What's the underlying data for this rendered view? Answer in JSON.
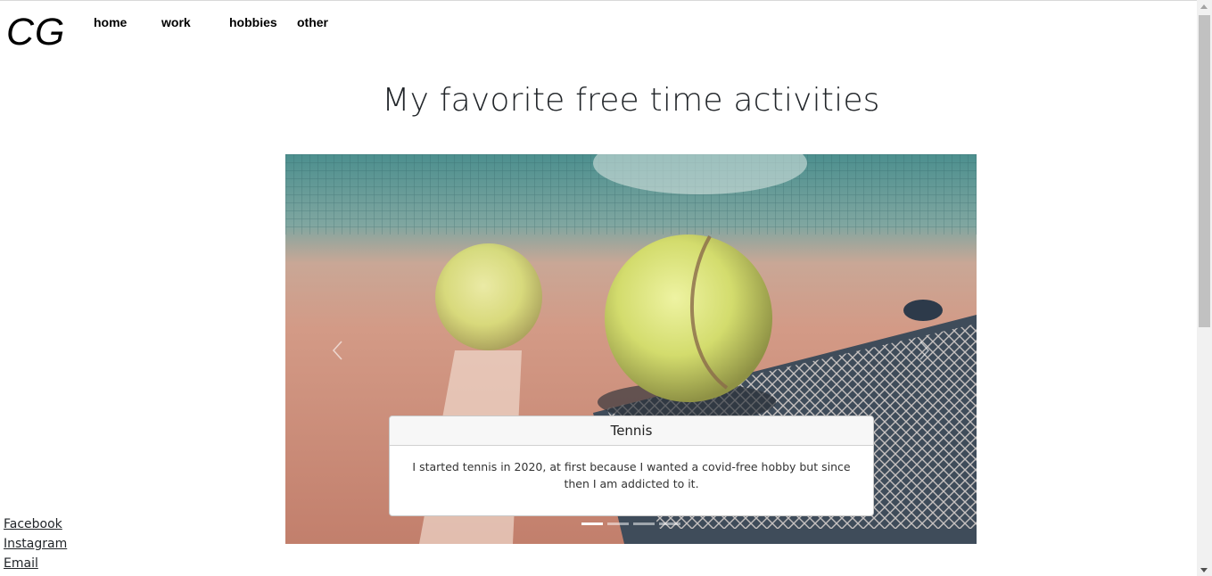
{
  "logo": "CG",
  "nav": {
    "items": [
      {
        "label": "home"
      },
      {
        "label": "work"
      },
      {
        "label": "hobbies"
      },
      {
        "label": "other"
      }
    ]
  },
  "page_title": "My favorite free time activities",
  "carousel": {
    "active_index": 0,
    "slide_count": 4,
    "slide": {
      "image": "tennis-balls-on-racket-clay-court",
      "caption_title": "Tennis",
      "caption_text": "I started tennis in 2020, at first because I wanted a covid-free hobby but since then I am addicted to it."
    }
  },
  "footer": {
    "links": [
      "Facebook",
      "Instagram",
      "Email"
    ]
  },
  "colors": {
    "text": "#212529",
    "nav_text": "#000000",
    "caption_bg": "#ffffff",
    "caption_header_bg": "#f7f7f7"
  }
}
